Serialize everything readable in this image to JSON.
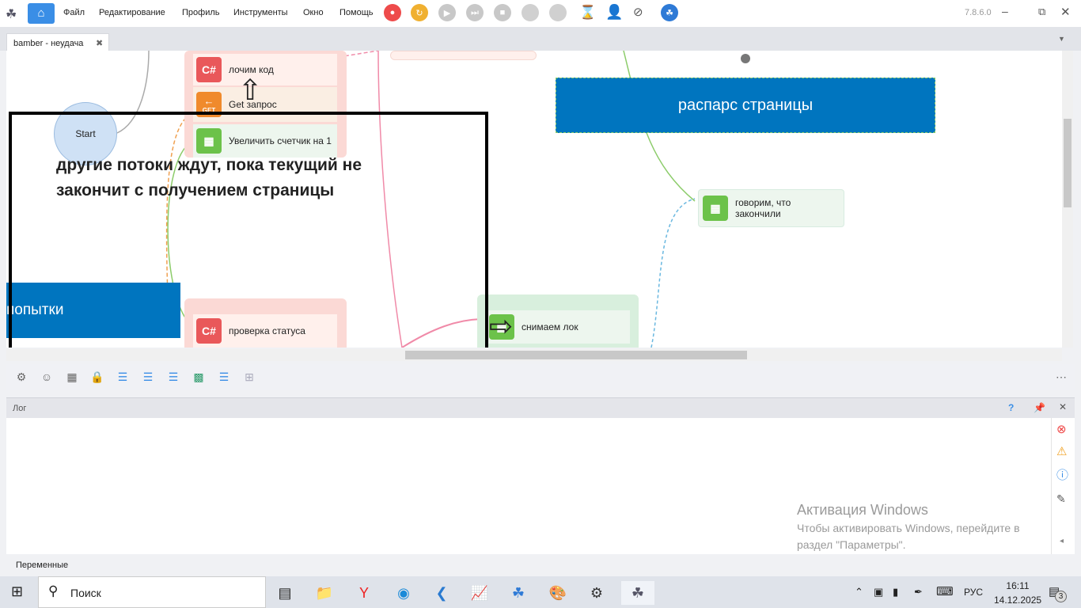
{
  "app": {
    "version": "7.8.6.0"
  },
  "menu": [
    "Файл",
    "Редактирование",
    "Профиль",
    "Инструменты",
    "Окно",
    "Помощь"
  ],
  "tab": {
    "title": "bamber - неудача"
  },
  "canvas": {
    "start": "Start",
    "nodes": {
      "lock_code": "лочим код",
      "get_request": "Get запрос",
      "get_badge": "GET",
      "increment": "Увеличить счетчик на 1",
      "check_status": "проверка статуса",
      "said_done": "говорим, что закончили",
      "unlock": "снимаем лок",
      "csharp": "C#"
    },
    "selected_block": "распарс страницы",
    "left_block": "попытки",
    "annotation": "другие потоки ждут, пока текущий не закончит с получением страницы"
  },
  "log": {
    "title": "Лог",
    "help": "?"
  },
  "bottom_tab": "Переменные",
  "watermark": {
    "title": "Активация Windows",
    "text": "Чтобы активировать Windows, перейдите в раздел \"Параметры\"."
  },
  "taskbar": {
    "search": "Поиск",
    "lang": "РУС",
    "time": "16:11",
    "date": "14.12.2025",
    "notifications": "3"
  }
}
